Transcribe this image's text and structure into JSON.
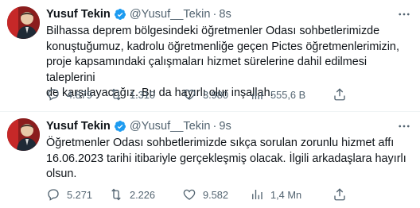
{
  "tweets": [
    {
      "author": {
        "name": "Yusuf Tekin",
        "handle": "@Yusuf__Tekin",
        "verified": true,
        "avatar_icon": "profile-photo"
      },
      "time": "8s",
      "text": "Bilhassa deprem bölgesindeki öğretmenler Odası sohbetlerimizde\nkonuştuğumuz, kadrolu öğretmenliğe geçen Pictes öğretmenlerimizin,\nproje kapsamındaki çalışmaları hizmet sürelerine dahil edilmesi taleplerini\nde karşılayacağız. Bu da hayırlı olur inşallah.",
      "stats": {
        "replies": "4.879",
        "retweets": "1.310",
        "likes": "3.980",
        "views": "555,6 B"
      }
    },
    {
      "author": {
        "name": "Yusuf Tekin",
        "handle": "@Yusuf__Tekin",
        "verified": true,
        "avatar_icon": "profile-photo"
      },
      "time": "9s",
      "text": "Öğretmenler Odası sohbetlerimizde sıkça sorulan zorunlu hizmet affı\n16.06.2023 tarihi itibariyle gerçekleşmiş olacak. İlgili arkadaşlara hayırlı\nolsun.",
      "stats": {
        "replies": "5.271",
        "retweets": "2.226",
        "likes": "9.582",
        "views": "1,4 Mn"
      }
    }
  ],
  "separator_dot": "·",
  "colors": {
    "text": "#0f1419",
    "muted": "#536471",
    "verified": "#1d9bf0",
    "divider": "#eff3f4"
  },
  "icons": [
    "more-icon",
    "verified-badge-icon",
    "reply-icon",
    "retweet-icon",
    "like-icon",
    "views-icon",
    "share-icon"
  ]
}
